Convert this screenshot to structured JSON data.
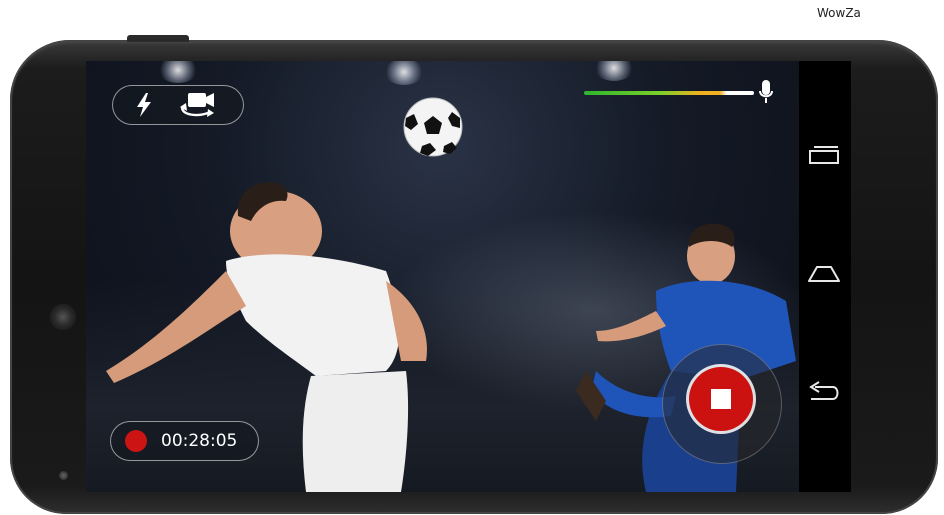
{
  "brand": {
    "label": "WowZa"
  },
  "camera": {
    "flash_icon": "flash-icon",
    "switch_camera_icon": "switch-camera-icon"
  },
  "recording": {
    "elapsed": "00:28:05",
    "state": "recording",
    "dot_color": "#cc1414"
  },
  "audio": {
    "level": 0.82,
    "mic_icon": "microphone-icon"
  },
  "record_button": {
    "icon": "stop-icon",
    "color": "#cc1111"
  },
  "system_nav": {
    "items": [
      "recent-apps-icon",
      "home-icon",
      "back-icon"
    ]
  }
}
